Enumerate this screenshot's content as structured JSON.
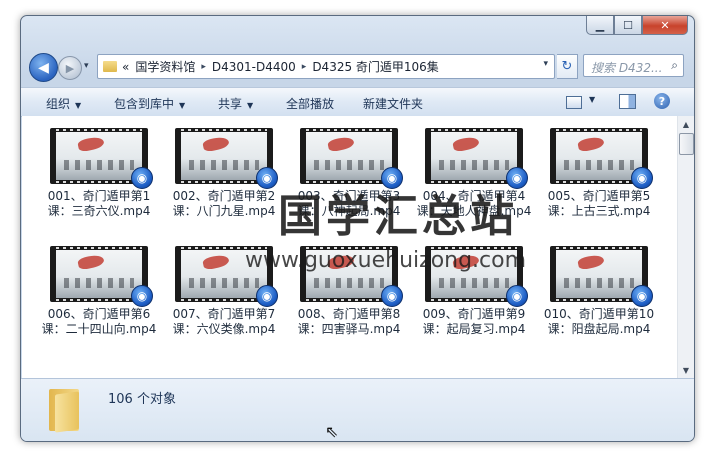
{
  "window": {
    "caption": {
      "minimize": "▁",
      "maximize": "☐",
      "close": "✕"
    }
  },
  "nav": {
    "back": "◀",
    "forward": "▶",
    "history": "▾",
    "breadcrumb_prefix": "«",
    "breadcrumbs": [
      "国学资料馆",
      "D4301-D4400",
      "D4325 奇门遁甲106集"
    ],
    "breadcrumb_separator": "▸",
    "address_dropdown": "▾",
    "refresh": "↻",
    "search_placeholder": "搜索 D432...",
    "search_icon": "⌕"
  },
  "toolbar": {
    "organize": "组织",
    "include_in_library": "包含到库中",
    "share": "共享",
    "play_all": "全部播放",
    "new_folder": "新建文件夹",
    "dropdown_glyph": "▼",
    "help": "?"
  },
  "files": [
    {
      "name": "001、奇门遁甲第1课：三奇六仪.mp4",
      "type": "video"
    },
    {
      "name": "002、奇门遁甲第2课：八门九星.mp4",
      "type": "video"
    },
    {
      "name": "003、奇门遁甲第3课：八神起局.mp4",
      "type": "video"
    },
    {
      "name": "004、奇门遁甲第4课：天地人神盘.mp4",
      "type": "video"
    },
    {
      "name": "005、奇门遁甲第5课：上古三式.mp4",
      "type": "video"
    },
    {
      "name": "006、奇门遁甲第6课：二十四山向.mp4",
      "type": "video"
    },
    {
      "name": "007、奇门遁甲第7课：六仪类像.mp4",
      "type": "video"
    },
    {
      "name": "008、奇门遁甲第8课：四害驿马.mp4",
      "type": "video"
    },
    {
      "name": "009、奇门遁甲第9课：起局复习.mp4",
      "type": "video"
    },
    {
      "name": "010、奇门遁甲第10课：阳盘起局.mp4",
      "type": "video"
    }
  ],
  "file_badge_icon": "◉",
  "scrollbar": {
    "up": "▲",
    "down": "▼"
  },
  "watermark": {
    "text": "国学汇总站",
    "url": "www.guoxuehuizong.com"
  },
  "details": {
    "count_text": "106 个对象"
  },
  "cursor": "⇖"
}
